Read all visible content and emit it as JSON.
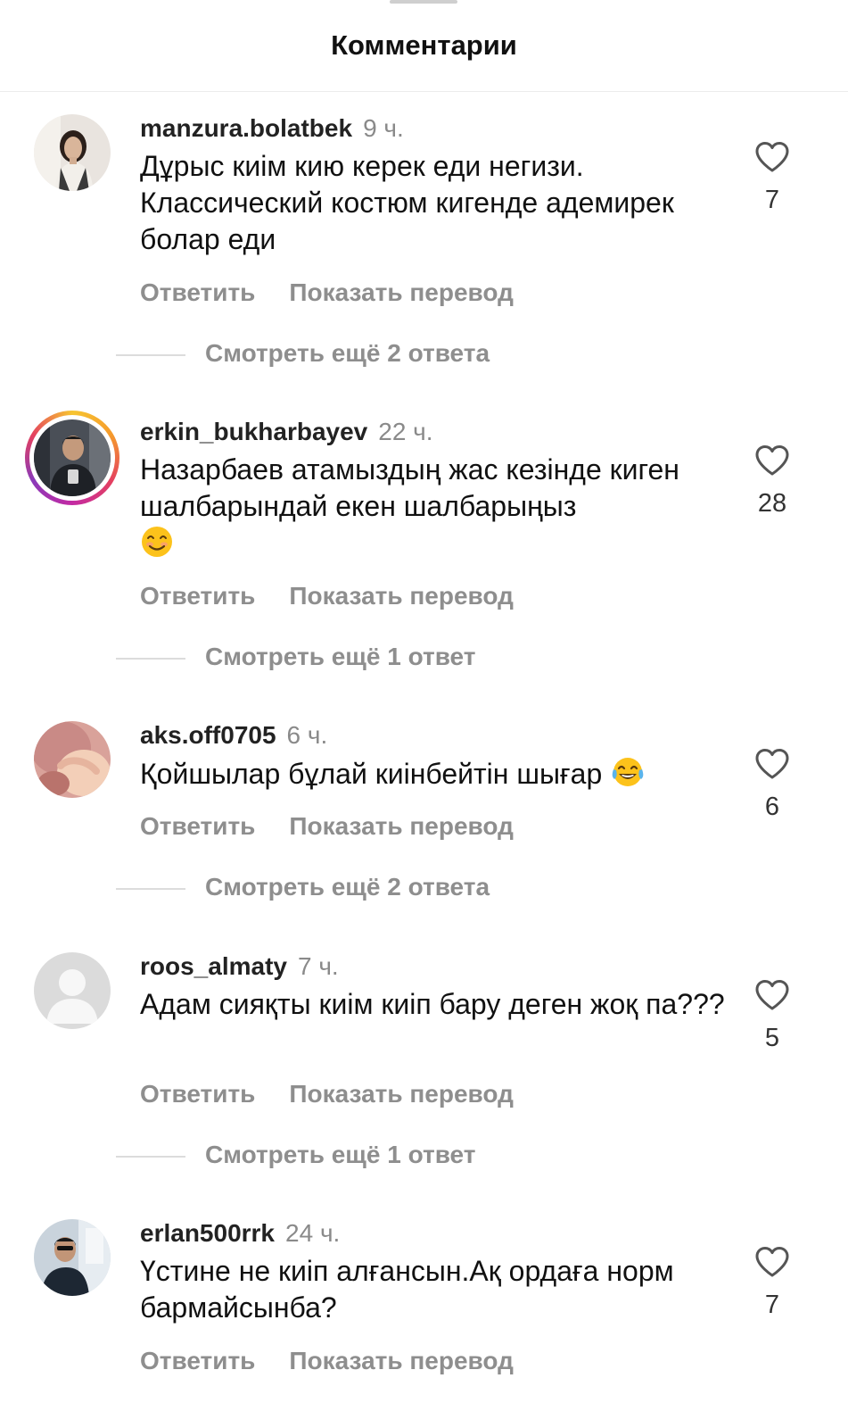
{
  "header": {
    "title": "Комментарии"
  },
  "comments": [
    {
      "username": "manzura.bolatbek",
      "time": "9 ч.",
      "text": "Дұрыс киім кию керек еди негизи. Классический костюм кигенде адемирек болар еди",
      "reply": "Ответить",
      "translate": "Показать перевод",
      "likes": "7",
      "more_replies": "Смотреть ещё 2 ответа"
    },
    {
      "username": "erkin_bukharbayev",
      "time": "22 ч.",
      "text": "Назарбаев атамыздың жас кезінде киген шалбарындай екен шалбарыңыз",
      "emoji": "smiling-face-emoji",
      "reply": "Ответить",
      "translate": "Показать перевод",
      "likes": "28",
      "more_replies": "Смотреть ещё 1 ответ"
    },
    {
      "username": "aks.off0705",
      "time": "6 ч.",
      "text": "Қойшылар бұлай киінбейтін шығар",
      "emoji": "tears-of-joy-emoji",
      "reply": "Ответить",
      "translate": "Показать перевод",
      "likes": "6",
      "more_replies": "Смотреть ещё 2 ответа"
    },
    {
      "username": "roos_almaty",
      "time": "7 ч.",
      "text": "Адам сияқты киім киіп бару деген жоқ па???",
      "reply": "Ответить",
      "translate": "Показать перевод",
      "likes": "5",
      "more_replies": "Смотреть ещё 1 ответ"
    },
    {
      "username": "erlan500rrk",
      "time": "24 ч.",
      "text": "Үстине не киіп алғансын.Ақ ордаға норм бармайсынба?",
      "reply": "Ответить",
      "translate": "Показать перевод",
      "likes": "7"
    }
  ],
  "colors": {
    "text": "#111111",
    "secondary": "#8e8e8e",
    "story_ring": "#e4405f"
  },
  "icons": {
    "like": "heart-outline-icon",
    "default_avatar": "person-silhouette-icon"
  }
}
